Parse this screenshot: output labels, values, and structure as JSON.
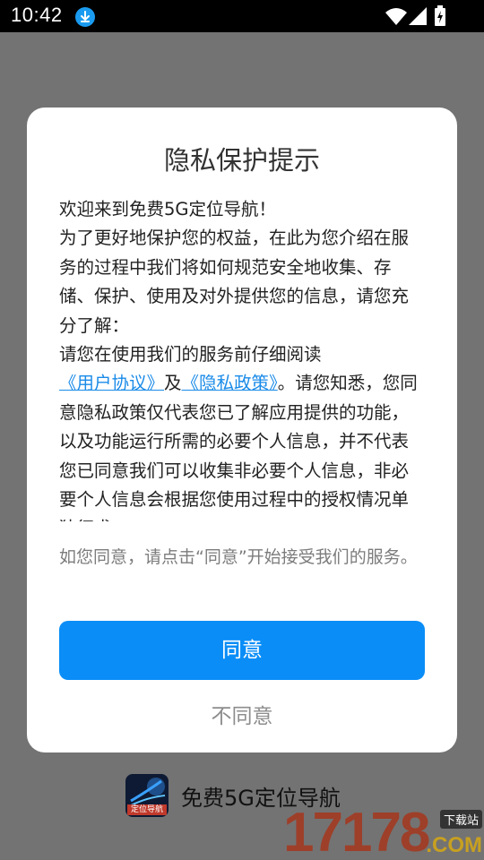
{
  "status_bar": {
    "time": "10:42",
    "icons": [
      "download-icon",
      "wifi-icon",
      "signal-icon",
      "battery-icon"
    ]
  },
  "dialog": {
    "title": "隐私保护提示",
    "greeting": "欢迎来到免费5G定位导航！",
    "intro": "为了更好地保护您的权益，在此为您介绍在服务的过程中我们将如何规范安全地收集、存储、保护、使用及对外提供您的信息，请您充分了解：",
    "read_prefix": "请您在使用我们的服务前仔细阅读",
    "user_agreement_link": "《用户协议》",
    "conjunction": "及",
    "privacy_policy_link": "《隐私政策》",
    "read_suffix": "。请您知悉，您同意隐私政策仅代表您已了解应用提供的功能，以及功能运行所需的必要个人信息，并不代表您已同意我们可以收集非必要个人信息，非必要个人信息会根据您使用过程中的授权情况单独征求",
    "footnote": "如您同意，请点击“同意”开始接受我们的服务。",
    "agree_label": "同意",
    "disagree_label": "不同意"
  },
  "footer": {
    "app_logo_text": "定位导航",
    "app_name": "免费5G定位导航"
  },
  "watermark": {
    "digits": "17178",
    "tag": "下载站",
    "suffix": ".COM"
  },
  "colors": {
    "accent": "#0a8df7",
    "link": "#1a8be8",
    "backdrop": "#737373"
  }
}
